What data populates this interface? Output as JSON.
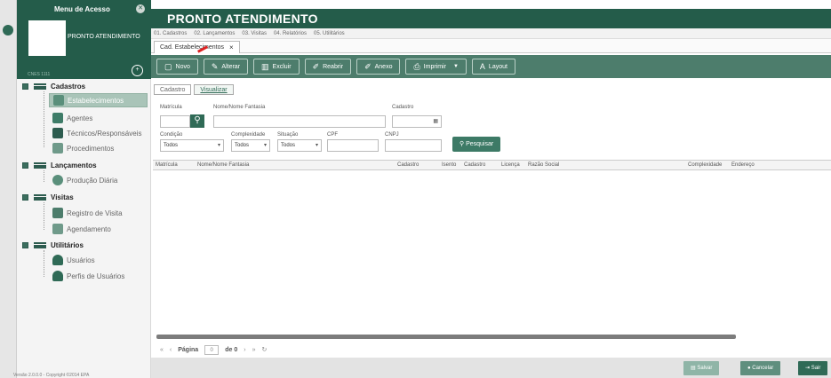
{
  "sidebar": {
    "menu_title": "Menu de Acesso",
    "module_name": "PRONTO ATENDIMENTO",
    "user_info": "CNES 1111",
    "groups": [
      {
        "label": "Cadastros",
        "items": [
          "Estabelecimentos",
          "Agentes",
          "Técnicos/Responsáveis",
          "Procedimentos"
        ]
      },
      {
        "label": "Lançamentos",
        "items": [
          "Produção Diária"
        ]
      },
      {
        "label": "Visitas",
        "items": [
          "Registro de Visita",
          "Agendamento"
        ]
      },
      {
        "label": "Utilitários",
        "items": [
          "Usuários",
          "Perfis de Usuários"
        ]
      }
    ],
    "version": "Versão 2.0.0.0 - Copyright ©2014 EPA"
  },
  "header": {
    "title": "PRONTO ATENDIMENTO",
    "menu": [
      "01. Cadastros",
      "02. Lançamentos",
      "03. Visitas",
      "04. Relatórios",
      "05. Utilitários"
    ]
  },
  "doc_tab": {
    "label": "Cad. Estabelecimentos",
    "close": "×"
  },
  "toolbar": {
    "novo": "Novo",
    "alterar": "Alterar",
    "excluir": "Excluir",
    "reabrir": "Reabrir",
    "anexo": "Anexo",
    "imprimir": "Imprimir",
    "layout": "Layout"
  },
  "inner_tabs": {
    "cadastro": "Cadastro",
    "visualizar": "Visualizar"
  },
  "form": {
    "matricula_label": "Matrícula",
    "nome_label": "Nome/Nome Fantasia",
    "cadastro_label": "Cadastro",
    "condicao_label": "Condição",
    "condicao_value": "Todos",
    "complexidade_label": "Complexidade",
    "complexidade_value": "Todos",
    "situacao_label": "Situação",
    "situacao_value": "Todos",
    "cpf_label": "CPF",
    "cnpj_label": "CNPJ",
    "pesquisar": "Pesquisar"
  },
  "grid": {
    "columns": [
      "Matrícula",
      "Nome/Nome Fantasia",
      "Cadastro",
      "Isento",
      "Cadastro",
      "Licença",
      "Razão Social",
      "Complexidade",
      "Endereço"
    ]
  },
  "pager": {
    "first": "«",
    "prev": "‹",
    "page_label": "Página",
    "page_value": "0",
    "of_label": "de 0",
    "next": "›",
    "last": "»",
    "refresh": "↻"
  },
  "footer": {
    "salvar": "Salvar",
    "cancelar": "Cancelar",
    "sair": "Sair"
  },
  "colors": {
    "primary": "#245c4a",
    "toolbar": "#4d7d6c",
    "selected": "#a9c4b8"
  }
}
